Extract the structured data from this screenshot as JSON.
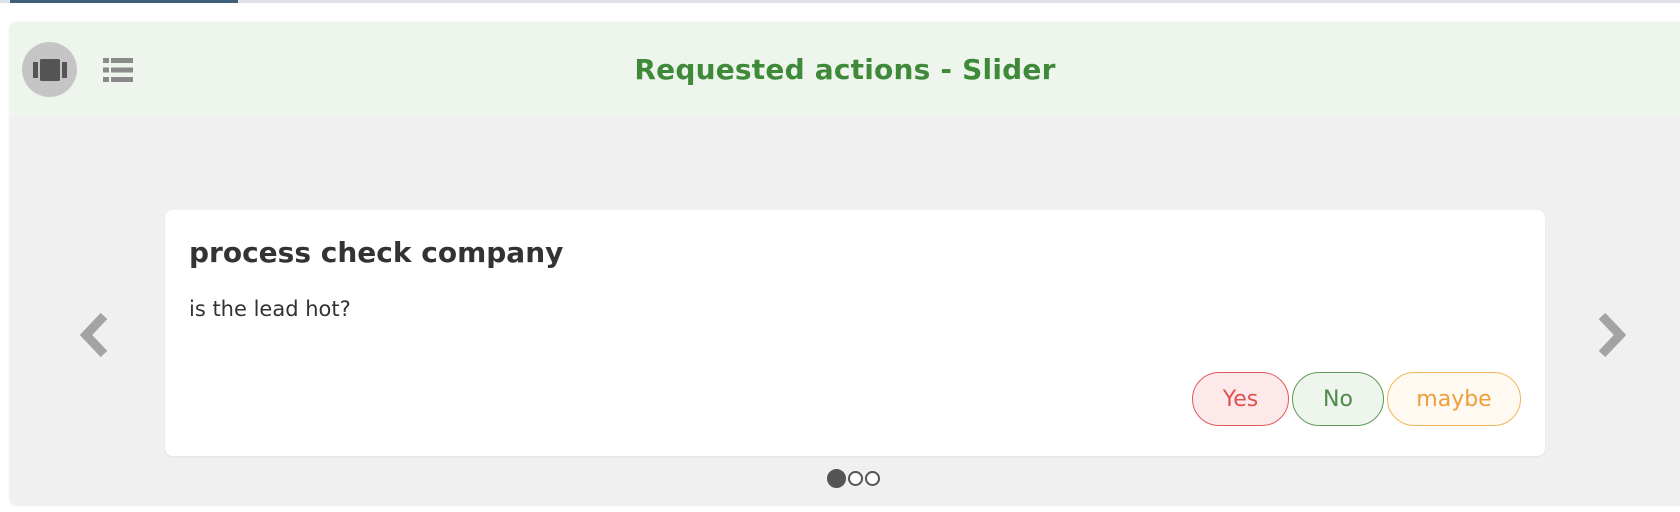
{
  "header": {
    "title": "Requested actions - Slider",
    "title_color": "#3f8a3a",
    "view_buttons": [
      {
        "icon": "carousel-icon",
        "active": true
      },
      {
        "icon": "list-icon",
        "active": false
      }
    ]
  },
  "slider": {
    "prev_icon": "chevron-left-icon",
    "next_icon": "chevron-right-icon",
    "current_slide": 1,
    "total_slides": 3
  },
  "card": {
    "title": "process check company",
    "question": "is the lead hot?",
    "answers": [
      {
        "label": "Yes",
        "color": "#df5252"
      },
      {
        "label": "No",
        "color": "#4f8a4a"
      },
      {
        "label": "maybe",
        "color": "#ee9e3a"
      }
    ]
  }
}
